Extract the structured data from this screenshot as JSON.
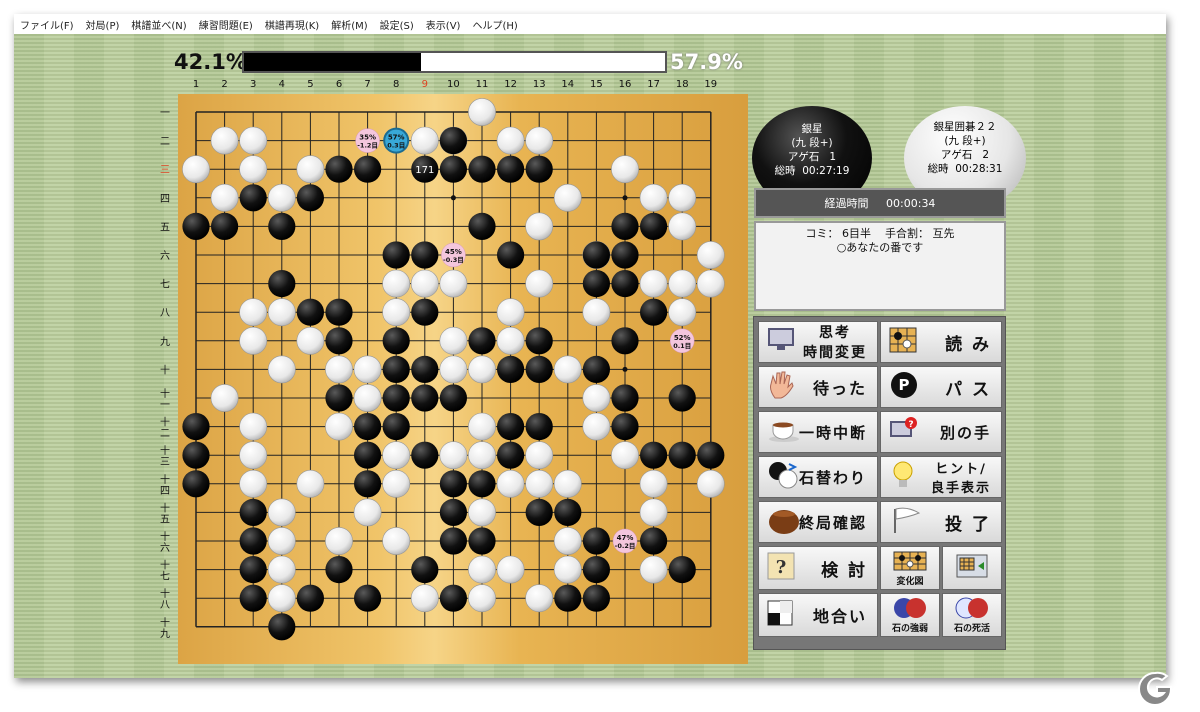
{
  "menu": [
    "ファイル(F)",
    "対局(P)",
    "棋譜並べ(N)",
    "練習問題(E)",
    "棋譜再現(K)",
    "解析(M)",
    "設定(S)",
    "表示(V)",
    "ヘルプ(H)"
  ],
  "win_rate": {
    "black_label": "42.1%",
    "white_label": "57.9%",
    "black_fraction": 0.421
  },
  "board": {
    "size": 19,
    "col_labels": [
      "1",
      "2",
      "3",
      "4",
      "5",
      "6",
      "7",
      "8",
      "9",
      "10",
      "11",
      "12",
      "13",
      "14",
      "15",
      "16",
      "17",
      "18",
      "19"
    ],
    "row_labels": [
      "一",
      "二",
      "三",
      "四",
      "五",
      "六",
      "七",
      "八",
      "九",
      "十",
      "十一",
      "十二",
      "十三",
      "十四",
      "十五",
      "十六",
      "十七",
      "十八",
      "十九"
    ],
    "highlight_col": "9",
    "highlight_row": "三",
    "black_stones": [
      [
        10,
        2
      ],
      [
        6,
        3
      ],
      [
        7,
        3
      ],
      [
        10,
        3
      ],
      [
        11,
        3
      ],
      [
        12,
        3
      ],
      [
        13,
        3
      ],
      [
        3,
        4
      ],
      [
        5,
        4
      ],
      [
        1,
        5
      ],
      [
        2,
        5
      ],
      [
        4,
        5
      ],
      [
        11,
        5
      ],
      [
        16,
        5
      ],
      [
        17,
        5
      ],
      [
        15,
        6
      ],
      [
        16,
        6
      ],
      [
        8,
        6
      ],
      [
        9,
        6
      ],
      [
        12,
        6
      ],
      [
        4,
        7
      ],
      [
        15,
        7
      ],
      [
        16,
        7
      ],
      [
        5,
        8
      ],
      [
        6,
        8
      ],
      [
        9,
        8
      ],
      [
        17,
        8
      ],
      [
        6,
        9
      ],
      [
        8,
        9
      ],
      [
        11,
        9
      ],
      [
        13,
        9
      ],
      [
        16,
        9
      ],
      [
        8,
        10
      ],
      [
        9,
        10
      ],
      [
        12,
        10
      ],
      [
        13,
        10
      ],
      [
        15,
        10
      ],
      [
        6,
        11
      ],
      [
        8,
        11
      ],
      [
        9,
        11
      ],
      [
        10,
        11
      ],
      [
        16,
        11
      ],
      [
        18,
        11
      ],
      [
        1,
        12
      ],
      [
        7,
        12
      ],
      [
        8,
        12
      ],
      [
        12,
        12
      ],
      [
        13,
        12
      ],
      [
        16,
        12
      ],
      [
        1,
        13
      ],
      [
        7,
        13
      ],
      [
        9,
        13
      ],
      [
        12,
        13
      ],
      [
        17,
        13
      ],
      [
        18,
        13
      ],
      [
        19,
        13
      ],
      [
        1,
        14
      ],
      [
        7,
        14
      ],
      [
        10,
        14
      ],
      [
        11,
        14
      ],
      [
        3,
        15
      ],
      [
        10,
        15
      ],
      [
        13,
        15
      ],
      [
        14,
        15
      ],
      [
        3,
        16
      ],
      [
        10,
        16
      ],
      [
        11,
        16
      ],
      [
        15,
        16
      ],
      [
        17,
        16
      ],
      [
        3,
        17
      ],
      [
        6,
        17
      ],
      [
        9,
        17
      ],
      [
        15,
        17
      ],
      [
        18,
        17
      ],
      [
        3,
        18
      ],
      [
        5,
        18
      ],
      [
        7,
        18
      ],
      [
        10,
        18
      ],
      [
        14,
        18
      ],
      [
        15,
        18
      ],
      [
        4,
        19
      ]
    ],
    "white_stones": [
      [
        11,
        1
      ],
      [
        2,
        2
      ],
      [
        3,
        2
      ],
      [
        9,
        2
      ],
      [
        10,
        2
      ],
      [
        12,
        2
      ],
      [
        13,
        2
      ],
      [
        1,
        3
      ],
      [
        3,
        3
      ],
      [
        5,
        3
      ],
      [
        16,
        3
      ],
      [
        2,
        4
      ],
      [
        4,
        4
      ],
      [
        14,
        4
      ],
      [
        17,
        4
      ],
      [
        18,
        4
      ],
      [
        13,
        5
      ],
      [
        18,
        5
      ],
      [
        15,
        6
      ],
      [
        19,
        6
      ],
      [
        9,
        7
      ],
      [
        8,
        7
      ],
      [
        10,
        7
      ],
      [
        13,
        7
      ],
      [
        17,
        7
      ],
      [
        18,
        7
      ],
      [
        19,
        7
      ],
      [
        3,
        8
      ],
      [
        4,
        8
      ],
      [
        8,
        8
      ],
      [
        12,
        8
      ],
      [
        15,
        8
      ],
      [
        18,
        8
      ],
      [
        3,
        9
      ],
      [
        5,
        9
      ],
      [
        10,
        9
      ],
      [
        12,
        9
      ],
      [
        4,
        10
      ],
      [
        6,
        10
      ],
      [
        7,
        10
      ],
      [
        10,
        10
      ],
      [
        11,
        10
      ],
      [
        14,
        10
      ],
      [
        2,
        11
      ],
      [
        7,
        11
      ],
      [
        15,
        11
      ],
      [
        3,
        12
      ],
      [
        6,
        12
      ],
      [
        11,
        12
      ],
      [
        15,
        12
      ],
      [
        3,
        13
      ],
      [
        8,
        13
      ],
      [
        10,
        13
      ],
      [
        11,
        13
      ],
      [
        13,
        13
      ],
      [
        16,
        13
      ],
      [
        3,
        14
      ],
      [
        5,
        14
      ],
      [
        8,
        14
      ],
      [
        12,
        14
      ],
      [
        13,
        14
      ],
      [
        14,
        14
      ],
      [
        17,
        14
      ],
      [
        19,
        14
      ],
      [
        4,
        15
      ],
      [
        7,
        15
      ],
      [
        11,
        15
      ],
      [
        17,
        15
      ],
      [
        4,
        16
      ],
      [
        6,
        16
      ],
      [
        8,
        16
      ],
      [
        14,
        16
      ],
      [
        4,
        17
      ],
      [
        11,
        17
      ],
      [
        12,
        17
      ],
      [
        14,
        17
      ],
      [
        17,
        17
      ],
      [
        4,
        18
      ],
      [
        9,
        18
      ],
      [
        11,
        18
      ],
      [
        13,
        18
      ]
    ],
    "last_move": {
      "x": 9,
      "y": 3,
      "label": "171"
    },
    "hints": [
      {
        "x": 7,
        "y": 2,
        "pct": "35%",
        "diff": "-1.2目",
        "style": "pink"
      },
      {
        "x": 8,
        "y": 2,
        "pct": "57%",
        "diff": "0.3目",
        "style": "blue"
      },
      {
        "x": 10,
        "y": 6,
        "pct": "45%",
        "diff": "-0.3目",
        "style": "pink"
      },
      {
        "x": 18,
        "y": 9,
        "pct": "52%",
        "diff": "0.1目",
        "style": "pink"
      },
      {
        "x": 16,
        "y": 16,
        "pct": "47%",
        "diff": "-0.2目",
        "style": "pink"
      }
    ]
  },
  "players": {
    "black": {
      "name": "銀星",
      "rank": "(九 段+)",
      "captured_label": "アゲ石",
      "captured": "1",
      "time_label": "総時",
      "time": "00:27:19"
    },
    "white": {
      "name": "銀星囲碁２２",
      "rank": "(九 段+)",
      "captured_label": "アゲ石",
      "captured": "2",
      "time_label": "総時",
      "time": "00:28:31"
    }
  },
  "elapsed": {
    "label": "経過時間",
    "value": "00:00:34"
  },
  "info": {
    "komi_label": "コミ：",
    "komi": "6目半",
    "handicap_label": "手合割：",
    "handicap": "互先",
    "turn_message": "○あなたの番です"
  },
  "buttons": {
    "think_time": "思考\n時間変更",
    "read": "読 み",
    "undo": "待った",
    "pass": "パ ス",
    "pause": "一時中断",
    "other_move": "別の手",
    "swap": "石替わり",
    "hint": "ヒント/\n良手表示",
    "end_check": "終局確認",
    "resign": "投 了",
    "review": "検 討",
    "variation": "変化図",
    "territory": "地合い",
    "stone_strength": "石の強弱",
    "life_death": "石の死活"
  },
  "colors": {
    "board": "#e2b04f",
    "tatami": "#b7cc98",
    "hint_pink": "#f4c6dd",
    "hint_blue": "#38a8d8"
  }
}
